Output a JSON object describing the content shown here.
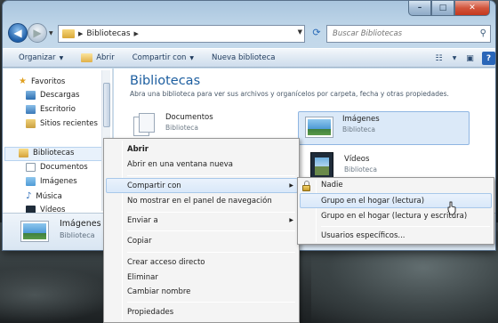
{
  "window": {
    "controls": {
      "minimize": "–",
      "maximize": "□",
      "close": "✕"
    }
  },
  "nav": {
    "breadcrumb": "Bibliotecas",
    "search_placeholder": "Buscar Bibliotecas"
  },
  "toolbar": {
    "organize": "Organizar",
    "open": "Abrir",
    "share": "Compartir con",
    "new_library": "Nueva biblioteca"
  },
  "sidebar": {
    "favorites": "Favoritos",
    "items": [
      "Descargas",
      "Escritorio",
      "Sitios recientes"
    ],
    "libraries": "Bibliotecas",
    "lib_items": [
      "Documentos",
      "Imágenes",
      "Música",
      "Vídeos"
    ]
  },
  "content": {
    "title": "Bibliotecas",
    "subtitle": "Abra una biblioteca para ver sus archivos y organícelos por carpeta, fecha y otras propiedades.",
    "libraries": [
      {
        "name": "Documentos",
        "kind": "Biblioteca"
      },
      {
        "name": "Imágenes",
        "kind": "Biblioteca"
      },
      {
        "name": "Vídeos",
        "kind": "Biblioteca"
      }
    ]
  },
  "details": {
    "name": "Imágenes",
    "kind": "Biblioteca"
  },
  "context_menu": {
    "items": [
      "Abrir",
      "Abrir en una ventana nueva",
      "Compartir con",
      "No mostrar en el panel de navegación",
      "Enviar a",
      "Copiar",
      "Crear acceso directo",
      "Eliminar",
      "Cambiar nombre",
      "Propiedades"
    ]
  },
  "share_submenu": {
    "items": [
      "Nadie",
      "Grupo en el hogar (lectura)",
      "Grupo en el hogar (lectura y escritura)",
      "Usuarios específicos..."
    ]
  },
  "colors": {
    "accent": "#1e5fa0",
    "selection": "#dbe9f8",
    "menu_bg": "#f4f4f4"
  }
}
